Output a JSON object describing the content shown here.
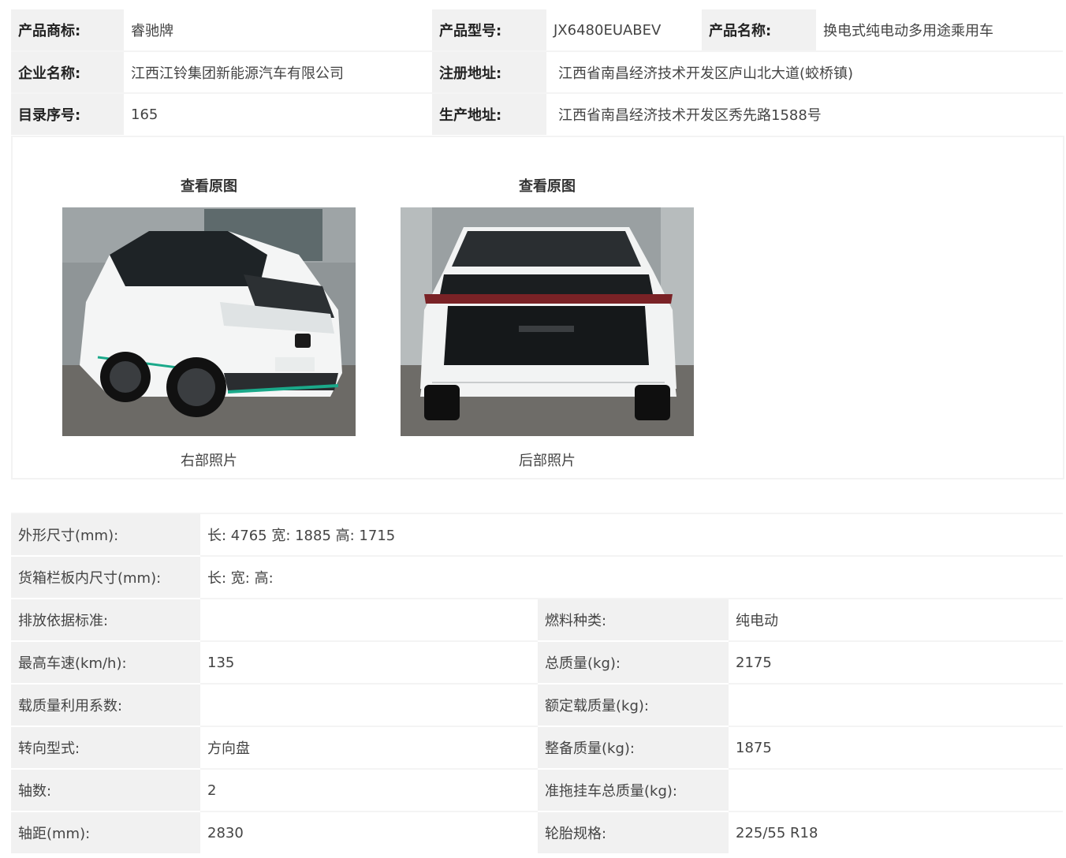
{
  "header": {
    "rows": [
      [
        {
          "label": "产品商标:",
          "value": "睿驰牌"
        },
        {
          "label": "产品型号:",
          "value": "JX6480EUABEV"
        },
        {
          "label": "产品名称:",
          "value": "换电式纯电动多用途乘用车"
        }
      ],
      [
        {
          "label": "企业名称:",
          "value": "江西江铃集团新能源汽车有限公司"
        },
        {
          "label": "注册地址:",
          "value": "江西省南昌经济技术开发区庐山北大道(蛟桥镇)"
        }
      ],
      [
        {
          "label": "目录序号:",
          "value": "165"
        },
        {
          "label": "生产地址:",
          "value": "江西省南昌经济技术开发区秀先路1588号"
        }
      ]
    ]
  },
  "photos": [
    {
      "link": "查看原图",
      "caption": "右部照片"
    },
    {
      "link": "查看原图",
      "caption": "后部照片"
    }
  ],
  "specs": {
    "dimensions": {
      "label": "外形尺寸(mm):",
      "value": "长: 4765 宽: 1885 高: 1715"
    },
    "cargo": {
      "label": "货箱栏板内尺寸(mm):",
      "value": "长:  宽:  高:"
    },
    "pairs": [
      [
        {
          "label": "排放依据标准:",
          "value": ""
        },
        {
          "label": "燃料种类:",
          "value": "纯电动"
        }
      ],
      [
        {
          "label": "最高车速(km/h):",
          "value": "135"
        },
        {
          "label": "总质量(kg):",
          "value": "2175"
        }
      ],
      [
        {
          "label": "载质量利用系数:",
          "value": ""
        },
        {
          "label": "额定载质量(kg):",
          "value": ""
        }
      ],
      [
        {
          "label": "转向型式:",
          "value": "方向盘"
        },
        {
          "label": "整备质量(kg):",
          "value": "1875"
        }
      ],
      [
        {
          "label": "轴数:",
          "value": "2"
        },
        {
          "label": "准拖挂车总质量(kg):",
          "value": ""
        }
      ],
      [
        {
          "label": "轴距(mm):",
          "value": "2830"
        },
        {
          "label": "轮胎规格:",
          "value": "225/55 R18"
        }
      ]
    ]
  },
  "colors": {
    "label_bg": "#f1f1f1",
    "accent_green": "#1aa98a"
  }
}
